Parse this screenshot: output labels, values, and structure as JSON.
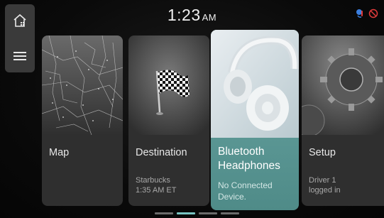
{
  "status": {
    "time": "1:23",
    "ampm": "AM",
    "icons": [
      "voice-assistant-icon",
      "mute-icon"
    ]
  },
  "rail": {
    "icons": [
      "home-icon",
      "menu-icon"
    ]
  },
  "cards": [
    {
      "title": "Map",
      "title2": "",
      "sub1": "",
      "sub2": "",
      "icon": "map-image"
    },
    {
      "title": "Destination",
      "title2": "",
      "sub1": "Starbucks",
      "sub2": "1:35 AM ET",
      "icon": "checkered-flag-image"
    },
    {
      "title": "Bluetooth",
      "title2": "Headphones",
      "sub1": "No Connected",
      "sub2": "Device.",
      "icon": "headphones-image"
    },
    {
      "title": "Setup",
      "title2": "",
      "sub1": "Driver 1",
      "sub2": "logged in",
      "icon": "gears-image"
    }
  ],
  "pager": {
    "count": 4,
    "active": 1
  },
  "colors": {
    "accent": "#79c4c2",
    "bt_card": "#5f9c99",
    "card": "#2f2f2f",
    "rail": "#3a3a3a"
  }
}
